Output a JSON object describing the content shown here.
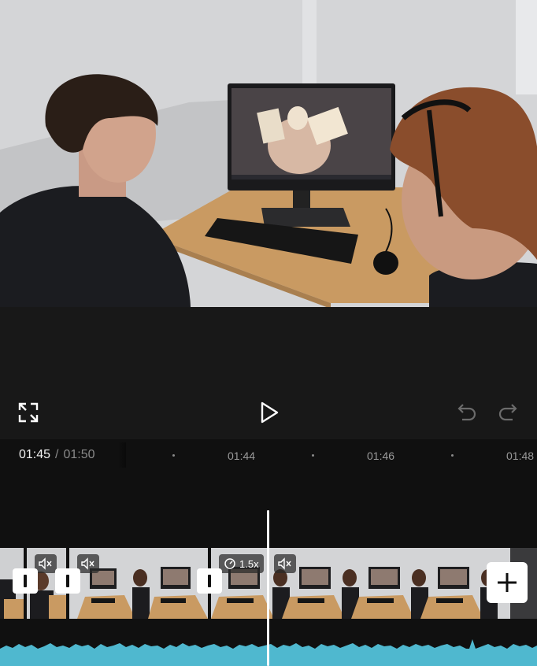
{
  "preview": {
    "image": "video-frame-two-men-at-desktop-computer"
  },
  "controls": {
    "fullscreen_icon": "fullscreen-icon",
    "play_icon": "play-icon",
    "undo_icon": "undo-icon",
    "redo_icon": "redo-icon"
  },
  "time": {
    "current": "01:45",
    "separator": "/",
    "total": "01:50"
  },
  "ruler": {
    "ticks": [
      "01:44",
      "01:46",
      "01:48"
    ]
  },
  "timeline": {
    "speed_label": "1.5x",
    "mute_icon": "muted-speaker-icon",
    "transition_icon": "transition-icon",
    "add_icon": "plus-icon"
  },
  "colors": {
    "background": "#181818",
    "timeline_bg": "#101010",
    "waveform": "#4fb8cf",
    "playhead": "#ffffff"
  }
}
